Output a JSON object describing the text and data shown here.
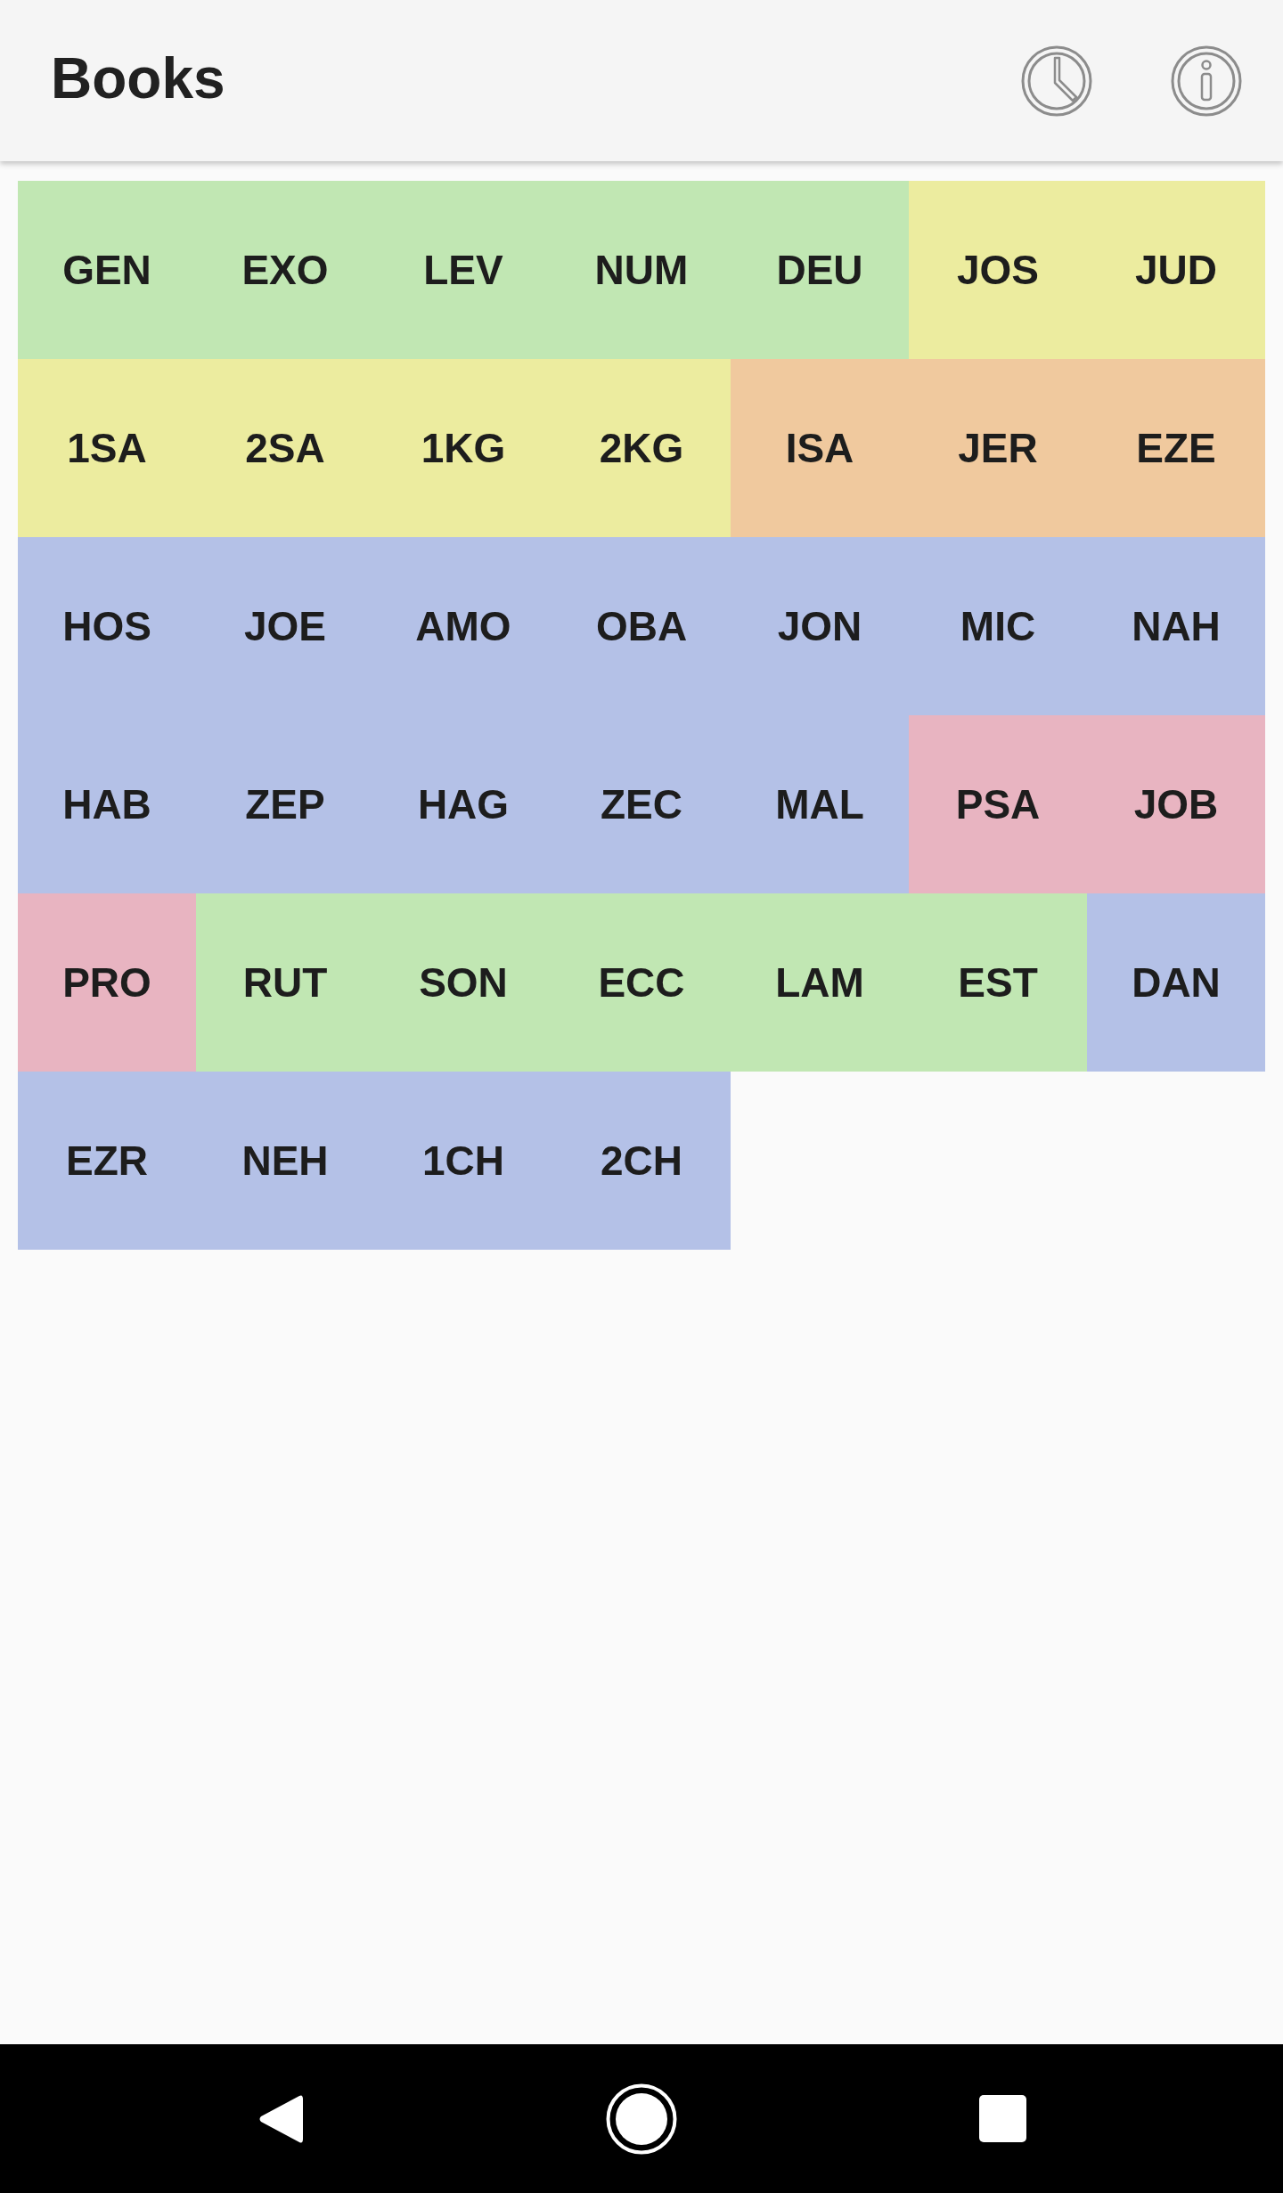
{
  "app_bar": {
    "title": "Books"
  },
  "books": [
    {
      "label": "GEN",
      "color": "#c1e7b3"
    },
    {
      "label": "EXO",
      "color": "#c1e7b3"
    },
    {
      "label": "LEV",
      "color": "#c1e7b3"
    },
    {
      "label": "NUM",
      "color": "#c1e7b3"
    },
    {
      "label": "DEU",
      "color": "#c1e7b3"
    },
    {
      "label": "JOS",
      "color": "#ecec9f"
    },
    {
      "label": "JUD",
      "color": "#ecec9f"
    },
    {
      "label": "1SA",
      "color": "#ecec9f"
    },
    {
      "label": "2SA",
      "color": "#ecec9f"
    },
    {
      "label": "1KG",
      "color": "#ecec9f"
    },
    {
      "label": "2KG",
      "color": "#ecec9f"
    },
    {
      "label": "ISA",
      "color": "#f0c99e"
    },
    {
      "label": "JER",
      "color": "#f0c99e"
    },
    {
      "label": "EZE",
      "color": "#f0c99e"
    },
    {
      "label": "HOS",
      "color": "#b4c1e7"
    },
    {
      "label": "JOE",
      "color": "#b4c1e7"
    },
    {
      "label": "AMO",
      "color": "#b4c1e7"
    },
    {
      "label": "OBA",
      "color": "#b4c1e7"
    },
    {
      "label": "JON",
      "color": "#b4c1e7"
    },
    {
      "label": "MIC",
      "color": "#b4c1e7"
    },
    {
      "label": "NAH",
      "color": "#b4c1e7"
    },
    {
      "label": "HAB",
      "color": "#b4c1e7"
    },
    {
      "label": "ZEP",
      "color": "#b4c1e7"
    },
    {
      "label": "HAG",
      "color": "#b4c1e7"
    },
    {
      "label": "ZEC",
      "color": "#b4c1e7"
    },
    {
      "label": "MAL",
      "color": "#b4c1e7"
    },
    {
      "label": "PSA",
      "color": "#e8b4c1"
    },
    {
      "label": "JOB",
      "color": "#e8b4c1"
    },
    {
      "label": "PRO",
      "color": "#e8b4c1"
    },
    {
      "label": "RUT",
      "color": "#c1e7b3"
    },
    {
      "label": "SON",
      "color": "#c1e7b3"
    },
    {
      "label": "ECC",
      "color": "#c1e7b3"
    },
    {
      "label": "LAM",
      "color": "#c1e7b3"
    },
    {
      "label": "EST",
      "color": "#c1e7b3"
    },
    {
      "label": "DAN",
      "color": "#b4c1e7"
    },
    {
      "label": "EZR",
      "color": "#b4c1e7"
    },
    {
      "label": "NEH",
      "color": "#b4c1e7"
    },
    {
      "label": "1CH",
      "color": "#b4c1e7"
    },
    {
      "label": "2CH",
      "color": "#b4c1e7"
    }
  ]
}
